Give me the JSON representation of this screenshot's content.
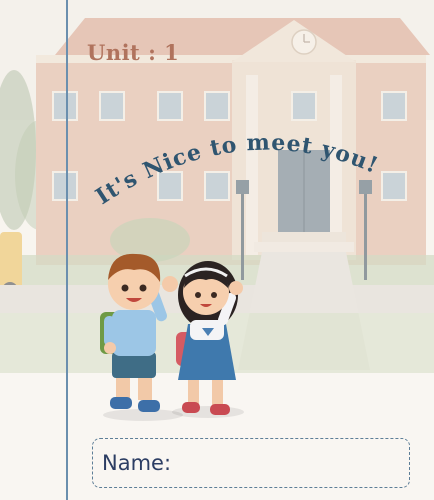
{
  "unit": {
    "label": "Unit : 1"
  },
  "title": {
    "text": "It's Nice to meet you!"
  },
  "name_field": {
    "label": "Name:"
  },
  "colors": {
    "unit_text": "#b0735d",
    "title_text": "#2f5570",
    "margin_line": "#6b8fae",
    "name_border": "#5d7e97",
    "name_text": "#2c3d63"
  },
  "icons": {
    "background": "school-building-illustration",
    "characters": "waving-children-illustration"
  }
}
